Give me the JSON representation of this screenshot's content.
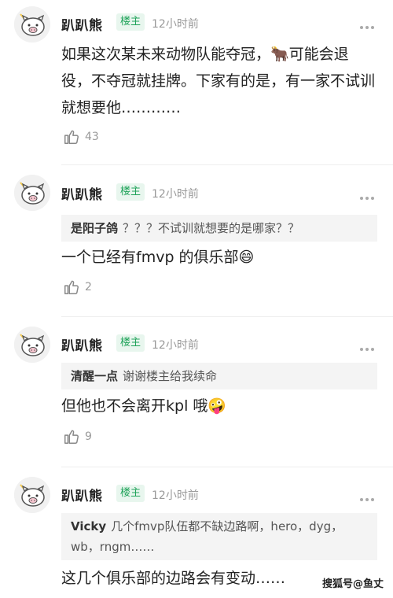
{
  "comments": [
    {
      "user": "趴趴熊",
      "badge": "楼主",
      "time": "12小时前",
      "text": "如果这次某未来动物队能夺冠，🐂可能会退役，不夺冠就挂牌。下家有的是，有一家不试训就想要他…………",
      "likes": "43"
    },
    {
      "user": "趴趴熊",
      "badge": "楼主",
      "time": "12小时前",
      "quote_user": "是阳子鸽",
      "quote_text": "？？？不试训就想要的是哪家？？",
      "text": "一个已经有fmvp 的俱乐部😄",
      "likes": "2"
    },
    {
      "user": "趴趴熊",
      "badge": "楼主",
      "time": "12小时前",
      "quote_user": "清醒一点",
      "quote_text": "谢谢楼主给我续命",
      "text": "但他也不会离开kpl 哦🤪",
      "likes": "9"
    },
    {
      "user": "趴趴熊",
      "badge": "楼主",
      "time": "12小时前",
      "quote_user": "Vicky",
      "quote_text": "几个fmvp队伍都不缺边路啊，hero，dyg，wb，rngm……",
      "text": "这几个俱乐部的边路会有变动……"
    }
  ],
  "watermark": "搜狐号@鱼丈",
  "colors": {
    "badge_bg": "#e8f6ee",
    "badge_text": "#20a35a",
    "quote_bg": "#f4f4f4"
  }
}
